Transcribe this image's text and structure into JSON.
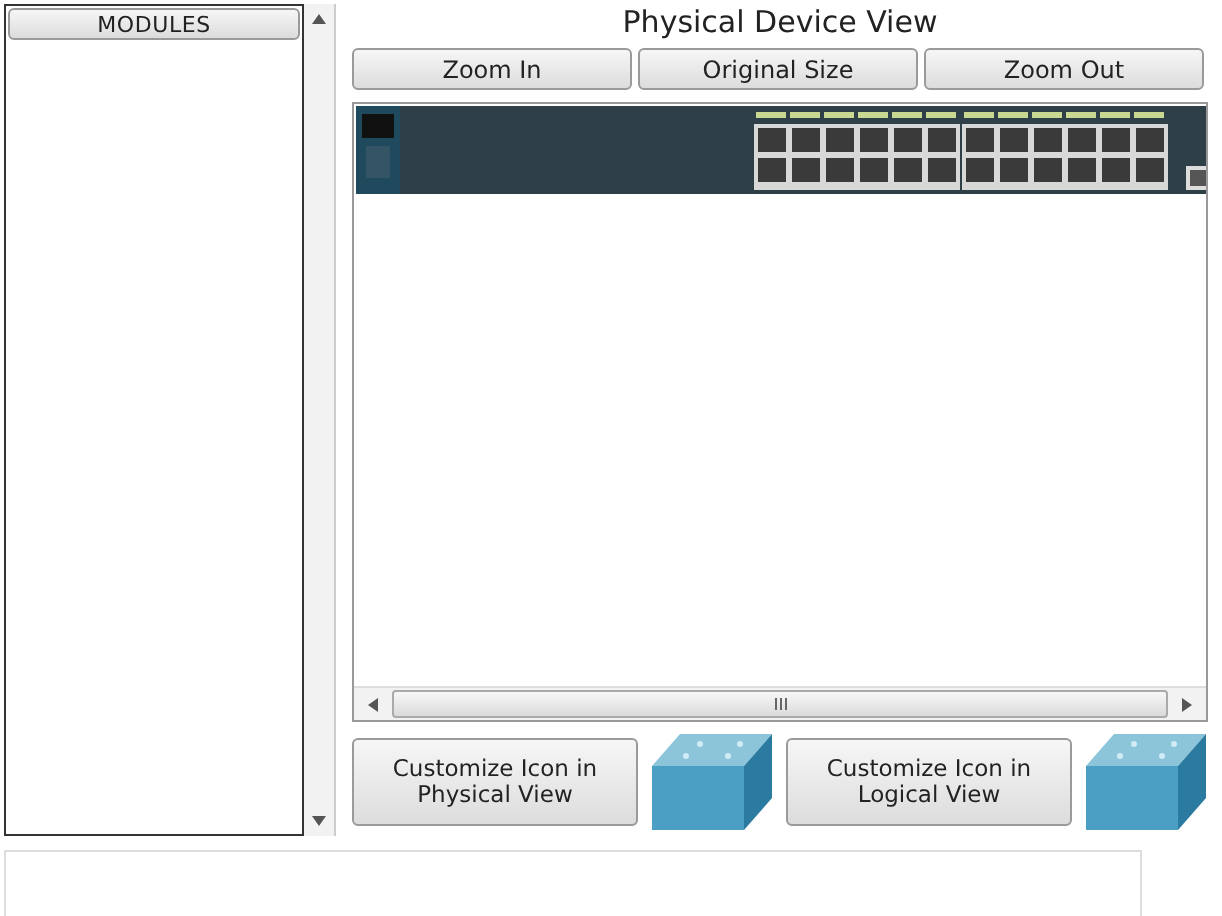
{
  "modules_panel": {
    "header": "MODULES"
  },
  "device_view": {
    "title": "Physical Device View",
    "zoom_buttons": [
      {
        "label": "Zoom In"
      },
      {
        "label": "Original Size"
      },
      {
        "label": "Zoom Out"
      }
    ]
  },
  "customize_buttons": [
    {
      "label": "Customize Icon in Physical View"
    },
    {
      "label": "Customize Icon in Logical View"
    }
  ]
}
